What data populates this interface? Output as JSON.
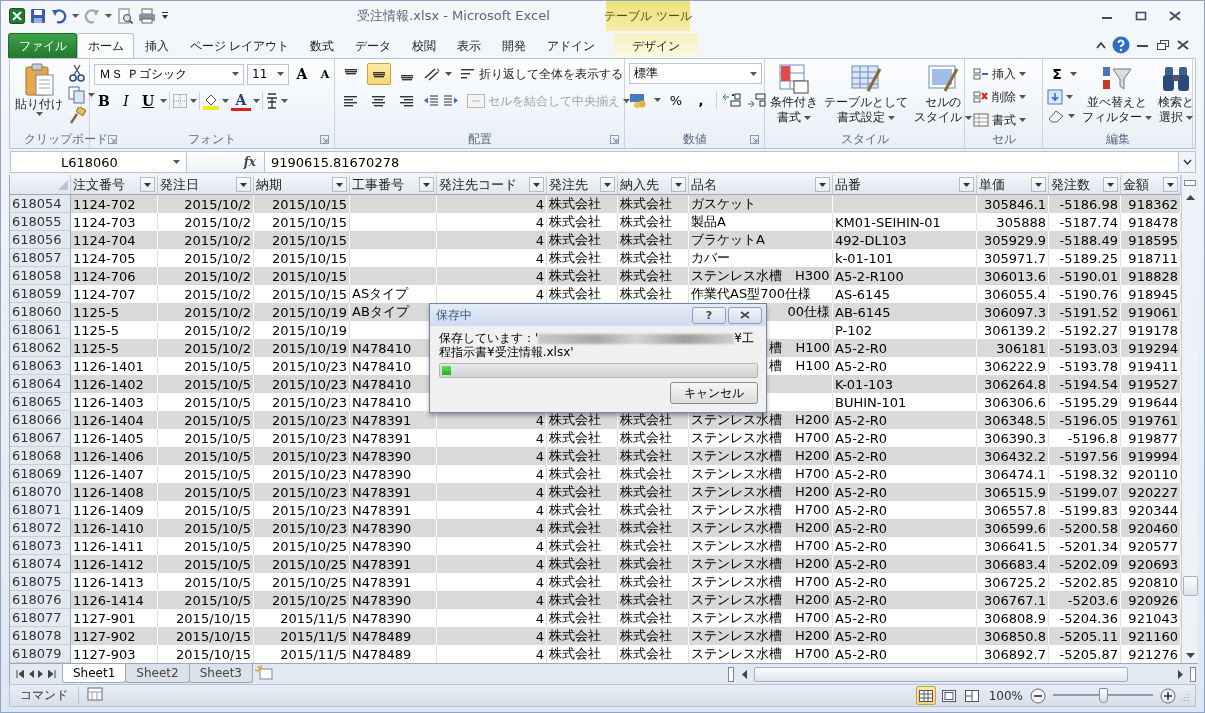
{
  "window": {
    "title": "受注情報.xlsx  -  Microsoft Excel",
    "context_header": "テーブル ツール"
  },
  "tabs": [
    {
      "label": "ファイル",
      "kind": "file",
      "selected": false
    },
    {
      "label": "ホーム",
      "kind": "normal",
      "selected": true
    },
    {
      "label": "挿入",
      "kind": "normal",
      "selected": false
    },
    {
      "label": "ページ レイアウト",
      "kind": "normal",
      "selected": false
    },
    {
      "label": "数式",
      "kind": "normal",
      "selected": false
    },
    {
      "label": "データ",
      "kind": "normal",
      "selected": false
    },
    {
      "label": "校閲",
      "kind": "normal",
      "selected": false
    },
    {
      "label": "表示",
      "kind": "normal",
      "selected": false
    },
    {
      "label": "開発",
      "kind": "normal",
      "selected": false
    },
    {
      "label": "アドイン",
      "kind": "normal",
      "selected": false
    },
    {
      "label": "デザイン",
      "kind": "context",
      "selected": false
    }
  ],
  "ribbon": {
    "clipboard": {
      "label": "クリップボード",
      "paste": "貼り付け"
    },
    "font": {
      "label": "フォント",
      "font_name": "ＭＳ Ｐゴシック",
      "font_size": "11",
      "grow": "A",
      "shrink": "A",
      "bold": "B",
      "italic": "I",
      "underline": "U",
      "font_color": "A"
    },
    "alignment": {
      "label": "配置",
      "vertical": [
        {
          "selected": false
        },
        {
          "selected": true
        },
        {
          "selected": false
        }
      ],
      "wrap": "折り返して全体を表示する",
      "merge": {
        "label": "セルを結合して中央揃え",
        "disabled": true
      }
    },
    "number": {
      "label": "数値",
      "format": "標準",
      "percent": "%",
      "comma": ","
    },
    "styles": {
      "label": "スタイル",
      "buttons": [
        {
          "lines": [
            "条件付き",
            "書式"
          ]
        },
        {
          "lines": [
            "テーブルとして",
            "書式設定"
          ]
        },
        {
          "lines": [
            "セルの",
            "スタイル"
          ]
        }
      ]
    },
    "cells": {
      "label": "セル",
      "buttons": [
        "挿入",
        "削除",
        "書式"
      ]
    },
    "editing": {
      "label": "編集",
      "sum": "Σ",
      "buttons": [
        {
          "lines": [
            "並べ替えと",
            "フィルター"
          ]
        },
        {
          "lines": [
            "検索と",
            "選択"
          ]
        }
      ]
    }
  },
  "formula_bar": {
    "name_box": "L618060",
    "fx": "fx",
    "value": "9190615.81670278"
  },
  "table": {
    "columns": [
      {
        "label": "注文番号",
        "kind": "text"
      },
      {
        "label": "発注日",
        "kind": "number"
      },
      {
        "label": "納期",
        "kind": "number"
      },
      {
        "label": "工事番号",
        "kind": "text"
      },
      {
        "label": "発注先コード",
        "kind": "number"
      },
      {
        "label": "発注先",
        "kind": "text"
      },
      {
        "label": "納入先",
        "kind": "text"
      },
      {
        "label": "品名",
        "kind": "text"
      },
      {
        "label": "品番",
        "kind": "text"
      },
      {
        "label": "単価",
        "kind": "number"
      },
      {
        "label": "発注数",
        "kind": "number"
      },
      {
        "label": "金額",
        "kind": "number"
      }
    ],
    "rows": [
      {
        "header": "618054",
        "cells": [
          "1124-702",
          "2015/10/2",
          "2015/10/15",
          null,
          "4",
          "株式会社",
          "株式会社",
          "ガスケット",
          null,
          "305846.1",
          "-5186.98",
          "918362"
        ]
      },
      {
        "header": "618055",
        "cells": [
          "1124-703",
          "2015/10/2",
          "2015/10/15",
          null,
          "4",
          "株式会社",
          "株式会社",
          "製品A",
          "KM01-SEIHIN-01",
          "305888",
          "-5187.74",
          "918478"
        ]
      },
      {
        "header": "618056",
        "cells": [
          "1124-704",
          "2015/10/2",
          "2015/10/15",
          null,
          "4",
          "株式会社",
          "株式会社",
          "ブラケットA",
          "492-DL103",
          "305929.9",
          "-5188.49",
          "918595"
        ]
      },
      {
        "header": "618057",
        "cells": [
          "1124-705",
          "2015/10/2",
          "2015/10/15",
          null,
          "4",
          "株式会社",
          "株式会社",
          "カバー",
          "k-01-101",
          "305971.7",
          "-5189.25",
          "918711"
        ]
      },
      {
        "header": "618058",
        "cells": [
          "1124-706",
          "2015/10/2",
          "2015/10/15",
          null,
          "4",
          "株式会社",
          "株式会社",
          "ステンレス水槽　H300",
          "A5-2-R100",
          "306013.6",
          "-5190.01",
          "918828"
        ]
      },
      {
        "header": "618059",
        "cells": [
          "1124-707",
          "2015/10/2",
          "2015/10/15",
          "ASタイプ",
          "4",
          "株式会社",
          "株式会社",
          "作業代AS型700仕様",
          "AS-6145",
          "306055.4",
          "-5190.76",
          "918945"
        ]
      },
      {
        "header": "618060",
        "cells": [
          "1125-5",
          "2015/10/2",
          "2015/10/19",
          "ABタイプ",
          null,
          null,
          null,
          {
            "text": "00仕様",
            "clipped": true
          },
          "AB-6145",
          "306097.3",
          "-5191.52",
          "919061"
        ]
      },
      {
        "header": "618061",
        "cells": [
          "1125-5",
          "2015/10/2",
          "2015/10/19",
          null,
          null,
          null,
          null,
          null,
          "P-102",
          "306139.2",
          "-5192.27",
          "919178"
        ]
      },
      {
        "header": "618062",
        "cells": [
          "1125-5",
          "2015/10/2",
          "2015/10/19",
          "N478410",
          null,
          null,
          null,
          {
            "text": "槽　H100",
            "clipped": true
          },
          "A5-2-R0",
          "306181",
          "-5193.03",
          "919294"
        ]
      },
      {
        "header": "618063",
        "cells": [
          "1126-1401",
          "2015/10/5",
          "2015/10/23",
          "N478410",
          null,
          null,
          null,
          {
            "text": "槽　H100",
            "clipped": true
          },
          "A5-2-R0",
          "306222.9",
          "-5193.78",
          "919411"
        ]
      },
      {
        "header": "618064",
        "cells": [
          "1126-1402",
          "2015/10/5",
          "2015/10/23",
          "N478410",
          null,
          null,
          null,
          null,
          "K-01-103",
          "306264.8",
          "-5194.54",
          "919527"
        ]
      },
      {
        "header": "618065",
        "cells": [
          "1126-1403",
          "2015/10/5",
          "2015/10/23",
          "N478410",
          null,
          null,
          null,
          null,
          "BUHIN-101",
          "306306.6",
          "-5195.29",
          "919644"
        ]
      },
      {
        "header": "618066",
        "cells": [
          "1126-1404",
          "2015/10/5",
          "2015/10/23",
          "N478391",
          "4",
          "株式会社",
          "株式会社",
          "ステンレス水槽　H200",
          "A5-2-R0",
          "306348.5",
          "-5196.05",
          "919761"
        ]
      },
      {
        "header": "618067",
        "cells": [
          "1126-1405",
          "2015/10/5",
          "2015/10/23",
          "N478391",
          "4",
          "株式会社",
          "株式会社",
          "ステンレス水槽　H700",
          "A5-2-R0",
          "306390.3",
          "-5196.8",
          "919877"
        ]
      },
      {
        "header": "618068",
        "cells": [
          "1126-1406",
          "2015/10/5",
          "2015/10/23",
          "N478390",
          "4",
          "株式会社",
          "株式会社",
          "ステンレス水槽　H200",
          "A5-2-R0",
          "306432.2",
          "-5197.56",
          "919994"
        ]
      },
      {
        "header": "618069",
        "cells": [
          "1126-1407",
          "2015/10/5",
          "2015/10/23",
          "N478390",
          "4",
          "株式会社",
          "株式会社",
          "ステンレス水槽　H700",
          "A5-2-R0",
          "306474.1",
          "-5198.32",
          "920110"
        ]
      },
      {
        "header": "618070",
        "cells": [
          "1126-1408",
          "2015/10/5",
          "2015/10/23",
          "N478391",
          "4",
          "株式会社",
          "株式会社",
          "ステンレス水槽　H200",
          "A5-2-R0",
          "306515.9",
          "-5199.07",
          "920227"
        ]
      },
      {
        "header": "618071",
        "cells": [
          "1126-1409",
          "2015/10/5",
          "2015/10/23",
          "N478391",
          "4",
          "株式会社",
          "株式会社",
          "ステンレス水槽　H700",
          "A5-2-R0",
          "306557.8",
          "-5199.83",
          "920344"
        ]
      },
      {
        "header": "618072",
        "cells": [
          "1126-1410",
          "2015/10/5",
          "2015/10/23",
          "N478390",
          "4",
          "株式会社",
          "株式会社",
          "ステンレス水槽　H200",
          "A5-2-R0",
          "306599.6",
          "-5200.58",
          "920460"
        ]
      },
      {
        "header": "618073",
        "cells": [
          "1126-1411",
          "2015/10/5",
          "2015/10/25",
          "N478390",
          "4",
          "株式会社",
          "株式会社",
          "ステンレス水槽　H700",
          "A5-2-R0",
          "306641.5",
          "-5201.34",
          "920577"
        ]
      },
      {
        "header": "618074",
        "cells": [
          "1126-1412",
          "2015/10/5",
          "2015/10/25",
          "N478391",
          "4",
          "株式会社",
          "株式会社",
          "ステンレス水槽　H200",
          "A5-2-R0",
          "306683.4",
          "-5202.09",
          "920693"
        ]
      },
      {
        "header": "618075",
        "cells": [
          "1126-1413",
          "2015/10/5",
          "2015/10/25",
          "N478391",
          "4",
          "株式会社",
          "株式会社",
          "ステンレス水槽　H700",
          "A5-2-R0",
          "306725.2",
          "-5202.85",
          "920810"
        ]
      },
      {
        "header": "618076",
        "cells": [
          "1126-1414",
          "2015/10/5",
          "2015/10/25",
          "N478390",
          "4",
          "株式会社",
          "株式会社",
          "ステンレス水槽　H200",
          "A5-2-R0",
          "306767.1",
          "-5203.6",
          "920926"
        ]
      },
      {
        "header": "618077",
        "cells": [
          "1127-901",
          "2015/10/15",
          "2015/11/5",
          "N478390",
          "4",
          "株式会社",
          "株式会社",
          "ステンレス水槽　H700",
          "A5-2-R0",
          "306808.9",
          "-5204.36",
          "921043"
        ]
      },
      {
        "header": "618078",
        "cells": [
          "1127-902",
          "2015/10/15",
          "2015/11/5",
          "N478489",
          "4",
          "株式会社",
          "株式会社",
          "ステンレス水槽　H200",
          "A5-2-R0",
          "306850.8",
          "-5205.11",
          "921160"
        ]
      },
      {
        "header": "618079",
        "cells": [
          "1127-903",
          "2015/10/15",
          "2015/11/5",
          "N478489",
          "4",
          "株式会社",
          "株式会社",
          "ステンレス水槽　H700",
          "A5-2-R0",
          "306892.7",
          "-5205.87",
          "921276"
        ]
      }
    ]
  },
  "dialog": {
    "title": "保存中",
    "help": "?",
    "message_start": "保存しています：'",
    "message_end": "¥工程指示書¥受注情報.xlsx'",
    "progress": {
      "level": 0.03
    },
    "cancel": "キャンセル"
  },
  "sheet_tabs": [
    {
      "label": "Sheet1",
      "selected": true
    },
    {
      "label": "Sheet2",
      "selected": false
    },
    {
      "label": "Sheet3",
      "selected": false
    }
  ],
  "status_bar": {
    "mode": "コマンド",
    "views": [
      {
        "selected": true
      },
      {
        "selected": false
      },
      {
        "selected": false
      }
    ],
    "zoom": "100%",
    "zoom_slider": {
      "level": 0.5
    }
  }
}
